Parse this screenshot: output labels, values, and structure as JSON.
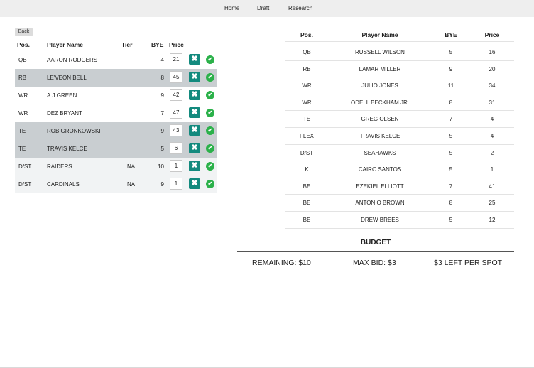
{
  "nav": {
    "home": "Home",
    "draft": "Draft",
    "research": "Research"
  },
  "back_label": "Back",
  "left_table": {
    "headers": {
      "pos": "Pos.",
      "name": "Player Name",
      "tier": "Tier",
      "bye": "BYE",
      "price": "Price"
    },
    "rows": [
      {
        "pos": "QB",
        "name": "AARON RODGERS",
        "tier": "",
        "bye": "4",
        "price": "21",
        "style": "white"
      },
      {
        "pos": "RB",
        "name": "LE'VEON BELL",
        "tier": "",
        "bye": "8",
        "price": "45",
        "style": "gray"
      },
      {
        "pos": "WR",
        "name": "A.J.GREEN",
        "tier": "",
        "bye": "9",
        "price": "42",
        "style": "white"
      },
      {
        "pos": "WR",
        "name": "DEZ BRYANT",
        "tier": "",
        "bye": "7",
        "price": "47",
        "style": "white"
      },
      {
        "pos": "TE",
        "name": "ROB GRONKOWSKI",
        "tier": "",
        "bye": "9",
        "price": "43",
        "style": "gray"
      },
      {
        "pos": "TE",
        "name": "TRAVIS KELCE",
        "tier": "",
        "bye": "5",
        "price": "6",
        "style": "gray"
      },
      {
        "pos": "D/ST",
        "name": "RAIDERS",
        "tier": "NA",
        "bye": "10",
        "price": "1",
        "style": "light"
      },
      {
        "pos": "D/ST",
        "name": "CARDINALS",
        "tier": "NA",
        "bye": "9",
        "price": "1",
        "style": "light"
      }
    ],
    "remove_icon": "x-icon",
    "confirm_icon": "check-circle-icon",
    "colors": {
      "remove_button": "#138a7e",
      "confirm_button": "#2bb14a",
      "highlight_row": "#c9ced1"
    }
  },
  "right_table": {
    "headers": {
      "pos": "Pos.",
      "name": "Player Name",
      "bye": "BYE",
      "price": "Price"
    },
    "rows": [
      {
        "pos": "QB",
        "name": "RUSSELL WILSON",
        "bye": "5",
        "price": "16"
      },
      {
        "pos": "RB",
        "name": "LAMAR MILLER",
        "bye": "9",
        "price": "20"
      },
      {
        "pos": "WR",
        "name": "JULIO JONES",
        "bye": "11",
        "price": "34"
      },
      {
        "pos": "WR",
        "name": "ODELL BECKHAM JR.",
        "bye": "8",
        "price": "31"
      },
      {
        "pos": "TE",
        "name": "GREG OLSEN",
        "bye": "7",
        "price": "4"
      },
      {
        "pos": "FLEX",
        "name": "TRAVIS KELCE",
        "bye": "5",
        "price": "4"
      },
      {
        "pos": "D/ST",
        "name": "SEAHAWKS",
        "bye": "5",
        "price": "2"
      },
      {
        "pos": "K",
        "name": "CAIRO SANTOS",
        "bye": "5",
        "price": "1"
      },
      {
        "pos": "BE",
        "name": "EZEKIEL ELLIOTT",
        "bye": "7",
        "price": "41"
      },
      {
        "pos": "BE",
        "name": "ANTONIO BROWN",
        "bye": "8",
        "price": "25"
      },
      {
        "pos": "BE",
        "name": "DREW BREES",
        "bye": "5",
        "price": "12"
      }
    ]
  },
  "budget": {
    "title": "BUDGET",
    "remaining": "REMAINING: $10",
    "max_bid": "MAX BID: $3",
    "left_per_spot": "$3 LEFT PER SPOT"
  }
}
